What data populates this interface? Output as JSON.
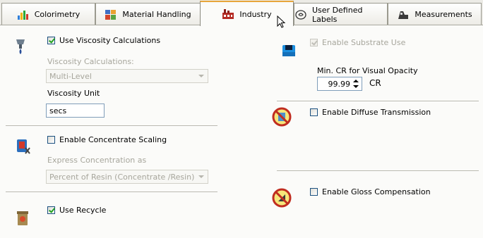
{
  "tabs": [
    {
      "label": "Colorimetry",
      "icon": "colorimetry-icon"
    },
    {
      "label": "Material Handling",
      "icon": "material-handling-icon"
    },
    {
      "label": "Industry",
      "icon": "industry-icon",
      "active": true
    },
    {
      "label": "User Defined Labels",
      "icon": "user-labels-icon"
    },
    {
      "label": "Measurements",
      "icon": "measurements-icon"
    }
  ],
  "viscosity": {
    "checkbox_label": "Use Viscosity Calculations",
    "checked": true,
    "calc_label": "Viscosity Calculations:",
    "calc_value": "Multi-Level",
    "unit_label": "Viscosity Unit",
    "unit_value": "secs"
  },
  "concentrate": {
    "checkbox_label": "Enable Concentrate Scaling",
    "checked": false,
    "express_label": "Express Concentration as",
    "express_value": "Percent of Resin (Concentrate /Resin)"
  },
  "recycle": {
    "checkbox_label": "Use Recycle",
    "checked": true
  },
  "substrate": {
    "checkbox_label": "Enable Substrate Use",
    "checked": true,
    "min_cr_label": "Min. CR for Visual Opacity",
    "min_cr_value": "99.99",
    "cr_unit": "CR"
  },
  "diffuse": {
    "checkbox_label": "Enable Diffuse Transmission",
    "checked": false
  },
  "gloss": {
    "checkbox_label": "Enable Gloss Compensation",
    "checked": false
  },
  "colors": {
    "accent_tab": "#e7a63b",
    "checkbox_border": "#1c5180",
    "check_mark": "#21a121",
    "page_bg": "#fbfbf9"
  }
}
